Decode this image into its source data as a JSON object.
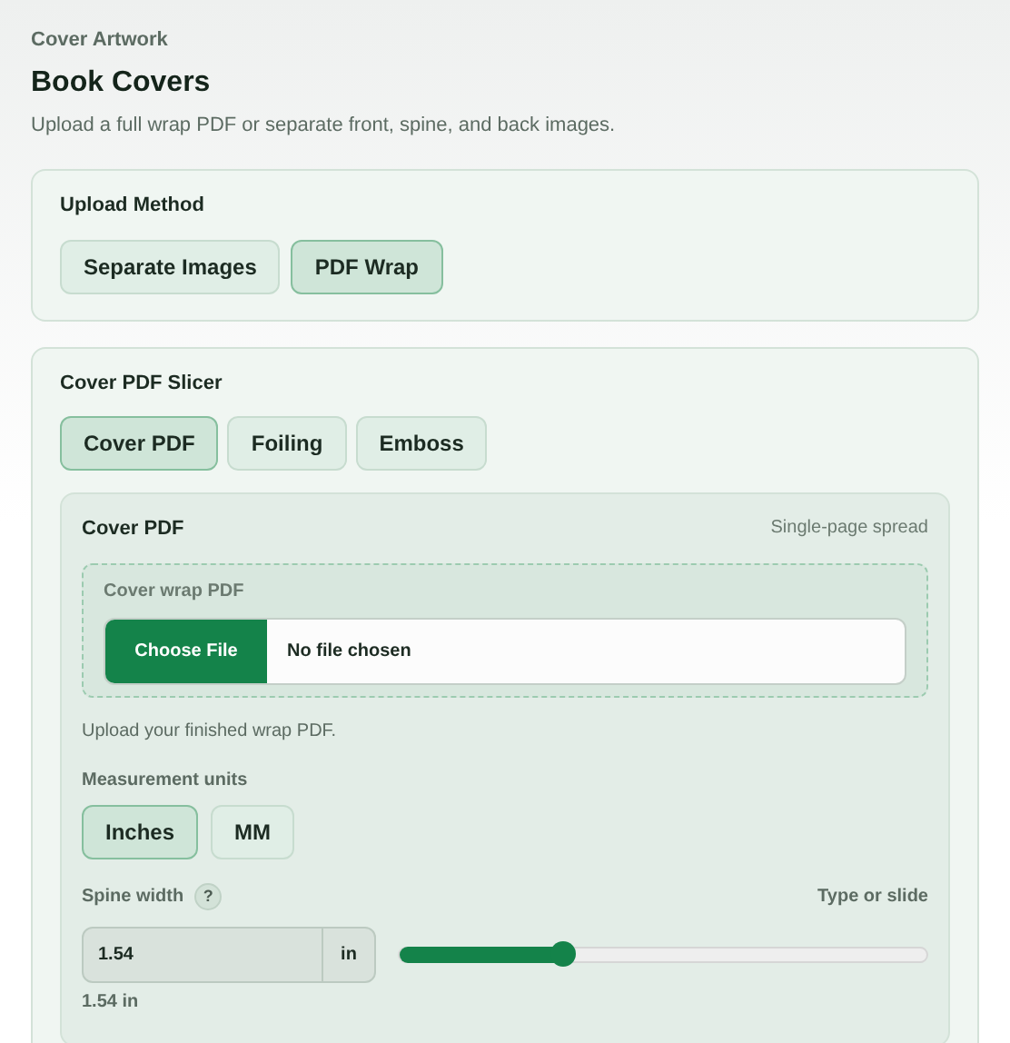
{
  "header": {
    "eyebrow": "Cover Artwork",
    "title": "Book Covers",
    "description": "Upload a full wrap PDF or separate front, spine, and back images."
  },
  "upload_method": {
    "label": "Upload Method",
    "options": [
      {
        "label": "Separate Images",
        "selected": false
      },
      {
        "label": "PDF Wrap",
        "selected": true
      }
    ]
  },
  "slicer": {
    "label": "Cover PDF Slicer",
    "tabs": [
      {
        "label": "Cover PDF",
        "selected": true
      },
      {
        "label": "Foiling",
        "selected": false
      },
      {
        "label": "Emboss",
        "selected": false
      }
    ],
    "panel": {
      "title": "Cover PDF",
      "note": "Single-page spread",
      "dropzone": {
        "label": "Cover wrap PDF",
        "button": "Choose File",
        "status": "No file chosen"
      },
      "help": "Upload your finished wrap PDF.",
      "units": {
        "label": "Measurement units",
        "options": [
          {
            "label": "Inches",
            "selected": true
          },
          {
            "label": "MM",
            "selected": false
          }
        ]
      },
      "spine": {
        "label": "Spine width",
        "help_icon": "?",
        "hint": "Type or slide",
        "value": "1.54",
        "unit": "in",
        "level": 0.31,
        "reading": "1.54 in"
      }
    }
  }
}
